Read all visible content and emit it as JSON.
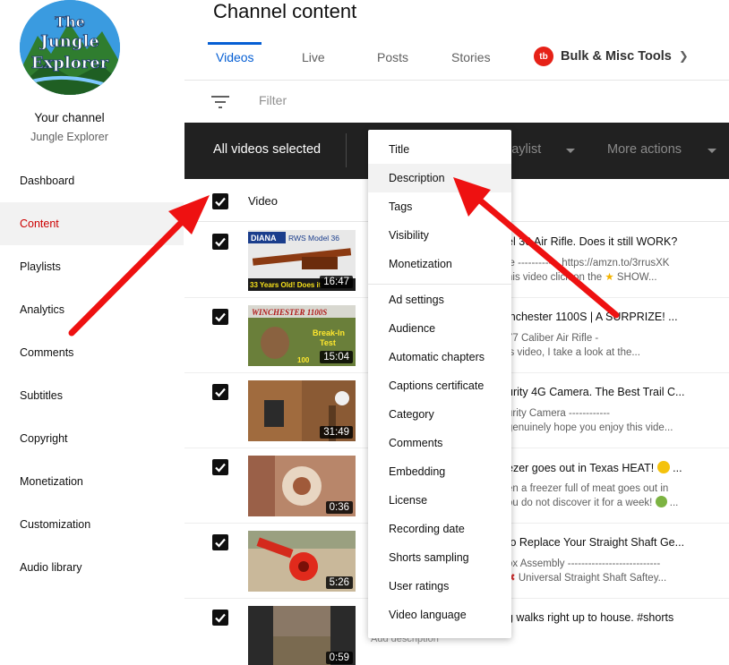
{
  "channel": {
    "logo_text_line1": "The",
    "logo_text_line2": "Jungle",
    "logo_text_line3": "Explorer",
    "your_channel_label": "Your channel",
    "handle": "Jungle Explorer"
  },
  "sidebar": {
    "items": [
      {
        "label": "Dashboard"
      },
      {
        "label": "Content",
        "active": true
      },
      {
        "label": "Playlists"
      },
      {
        "label": "Analytics"
      },
      {
        "label": "Comments"
      },
      {
        "label": "Subtitles"
      },
      {
        "label": "Copyright"
      },
      {
        "label": "Monetization"
      },
      {
        "label": "Customization"
      },
      {
        "label": "Audio library"
      }
    ]
  },
  "header": {
    "title": "Channel content",
    "tabs": [
      {
        "label": "Videos",
        "active": true
      },
      {
        "label": "Live"
      },
      {
        "label": "Posts"
      },
      {
        "label": "Stories"
      }
    ],
    "bulk_tool_label": "Bulk & Misc Tools",
    "bulk_tool_logo": "tb"
  },
  "filter": {
    "placeholder": "Filter"
  },
  "selection_bar": {
    "text": "All videos selected",
    "playlist_partial": "laylist",
    "more_actions": "More actions"
  },
  "table": {
    "column_video": "Video",
    "add_description": "Add description",
    "rows": [
      {
        "duration": "16:47",
        "thumb_label_1": "DIANA",
        "thumb_label_2": "RWS Model 36",
        "thumb_label_3": "33 Years Old! Does it",
        "title": "el 36 Air Rifle. Does it still WORK?",
        "desc1": "le ------------ https://amzn.to/3rrusXK",
        "desc2a": "his video click on the",
        "desc2b": "SHOW..."
      },
      {
        "duration": "15:04",
        "thumb_label_1": "WINCHESTER 1100S",
        "thumb_label_2": "Break-In",
        "thumb_label_3": "Test",
        "thumb_label_4": "100",
        "title": "inchester 1100S | A SURPRIZE! ...",
        "desc1": "77 Caliber Air Rifle -",
        "desc2a": "is video, I take a look at the...",
        "desc2b": ""
      },
      {
        "duration": "31:49",
        "title": "urity 4G Camera. The Best Trail C...",
        "desc1": "urity Camera ------------",
        "desc2a": "genuinely hope you enjoy this vide...",
        "desc2b": ""
      },
      {
        "duration": "0:36",
        "title": "ezer goes out in Texas HEAT!",
        "title_suffix": "...",
        "desc1": "en a freezer full of meat goes out in",
        "desc2a": "ou do not discover it for a week!",
        "desc2b": "..."
      },
      {
        "duration": "5:26",
        "title": "to Replace Your Straight Shaft Ge...",
        "desc1": "ox Assembly ---------------------------",
        "desc2a": "",
        "desc2b": "Universal Straight Shaft Saftey..."
      },
      {
        "duration": "0:59",
        "title": "g walks right up to house. #shorts",
        "desc1": "",
        "desc2a": "",
        "desc2b": ""
      }
    ]
  },
  "menu": {
    "group1": [
      "Title",
      "Description",
      "Tags",
      "Visibility",
      "Monetization"
    ],
    "group2": [
      "Ad settings",
      "Audience",
      "Automatic chapters",
      "Captions certificate",
      "Category",
      "Comments",
      "Embedding",
      "License",
      "Recording date",
      "Shorts sampling",
      "User ratings",
      "Video language"
    ],
    "hovered": "Description"
  },
  "colors": {
    "accent_blue": "#065fd4",
    "active_red": "#cc0000",
    "selection_bar": "#212121",
    "annotation_arrow": "#ee1111"
  }
}
